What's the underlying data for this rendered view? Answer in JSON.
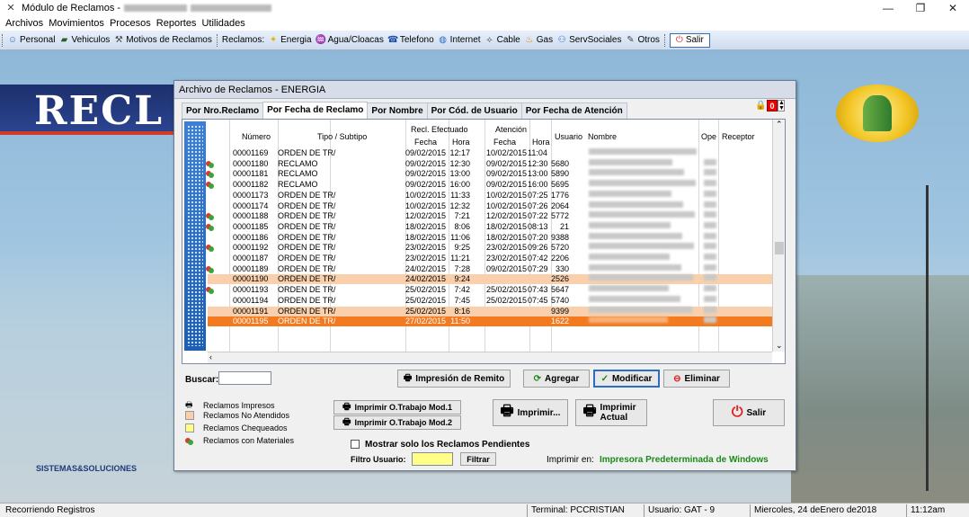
{
  "window": {
    "title": "Módulo de Reclamos - ",
    "minimize": "—",
    "maximize": "❐",
    "close": "✕"
  },
  "menu": [
    "Archivos",
    "Movimientos",
    "Procesos",
    "Reportes",
    "Utilidades"
  ],
  "toolbar": {
    "group1": [
      "Personal",
      "Vehiculos",
      "Motivos de Reclamos"
    ],
    "reclamos_label": "Reclamos:",
    "group2": [
      "Energia",
      "Agua/Cloacas",
      "Telefono",
      "Internet",
      "Cable",
      "Gas",
      "ServSociales",
      "Otros"
    ],
    "salir": "Salir"
  },
  "desktop": {
    "brand_text": "RECL",
    "sis_text": "SISTEMAS&SOLUCIONES"
  },
  "dialog": {
    "title": "Archivo de Reclamos - ENERGIA",
    "tabs": [
      "Por Nro.Reclamo",
      "Por Fecha de Reclamo",
      "Por Nombre",
      "Por Cód. de Usuario",
      "Por Fecha de Atención"
    ],
    "counter": "0",
    "headers": {
      "numero": "Número",
      "tipo": "Tipo / Subtipo",
      "recl_efect": "Recl. Efectuado",
      "atencion": "Atención",
      "fecha": "Fecha",
      "hora": "Hora",
      "fecha2": "Fecha",
      "hora2": "Hora",
      "usuario": "Usuario",
      "nombre": "Nombre",
      "ope": "Ope",
      "receptor": "Receptor"
    },
    "rows": [
      {
        "num": "00001169",
        "tipo": "ORDEN DE TR/",
        "fecha": "09/02/2015",
        "hora": "12:17",
        "afecha": "10/02/2015",
        "ahora": "11:04",
        "usuario": "",
        "mat": false,
        "sel": ""
      },
      {
        "num": "00001180",
        "tipo": "RECLAMO",
        "fecha": "09/02/2015",
        "hora": "12:30",
        "afecha": "09/02/2015",
        "ahora": "12:30",
        "usuario": "5680",
        "mat": true,
        "sel": ""
      },
      {
        "num": "00001181",
        "tipo": "RECLAMO",
        "fecha": "09/02/2015",
        "hora": "13:00",
        "afecha": "09/02/2015",
        "ahora": "13:00",
        "usuario": "5890",
        "mat": true,
        "sel": ""
      },
      {
        "num": "00001182",
        "tipo": "RECLAMO",
        "fecha": "09/02/2015",
        "hora": "16:00",
        "afecha": "09/02/2015",
        "ahora": "16:00",
        "usuario": "5695",
        "mat": true,
        "sel": ""
      },
      {
        "num": "00001173",
        "tipo": "ORDEN DE TR/",
        "fecha": "10/02/2015",
        "hora": "11:33",
        "afecha": "10/02/2015",
        "ahora": "07:25",
        "usuario": "1776",
        "mat": false,
        "sel": ""
      },
      {
        "num": "00001174",
        "tipo": "ORDEN DE TR/",
        "fecha": "10/02/2015",
        "hora": "12:32",
        "afecha": "10/02/2015",
        "ahora": "07:26",
        "usuario": "2064",
        "mat": false,
        "sel": ""
      },
      {
        "num": "00001188",
        "tipo": "ORDEN DE TR/",
        "fecha": "12/02/2015",
        "hora": "7:21",
        "afecha": "12/02/2015",
        "ahora": "07:22",
        "usuario": "5772",
        "mat": true,
        "sel": ""
      },
      {
        "num": "00001185",
        "tipo": "ORDEN DE TR/",
        "fecha": "18/02/2015",
        "hora": "8:06",
        "afecha": "18/02/2015",
        "ahora": "08:13",
        "usuario": "21",
        "mat": true,
        "sel": ""
      },
      {
        "num": "00001186",
        "tipo": "ORDEN DE TR/",
        "fecha": "18/02/2015",
        "hora": "11:06",
        "afecha": "18/02/2015",
        "ahora": "07:20",
        "usuario": "9388",
        "mat": false,
        "sel": ""
      },
      {
        "num": "00001192",
        "tipo": "ORDEN DE TR/",
        "fecha": "23/02/2015",
        "hora": "9:25",
        "afecha": "23/02/2015",
        "ahora": "09:26",
        "usuario": "5720",
        "mat": true,
        "sel": ""
      },
      {
        "num": "00001187",
        "tipo": "ORDEN DE TR/",
        "fecha": "23/02/2015",
        "hora": "11:21",
        "afecha": "23/02/2015",
        "ahora": "07:42",
        "usuario": "2206",
        "mat": false,
        "sel": ""
      },
      {
        "num": "00001189",
        "tipo": "ORDEN DE TR/",
        "fecha": "24/02/2015",
        "hora": "7:28",
        "afecha": "09/02/2015",
        "ahora": "07:29",
        "usuario": "330",
        "mat": true,
        "sel": ""
      },
      {
        "num": "00001190",
        "tipo": "ORDEN DE TR/",
        "fecha": "24/02/2015",
        "hora": "9:24",
        "afecha": "",
        "ahora": "",
        "usuario": "2526",
        "mat": false,
        "sel": "light"
      },
      {
        "num": "00001193",
        "tipo": "ORDEN DE TR/",
        "fecha": "25/02/2015",
        "hora": "7:42",
        "afecha": "25/02/2015",
        "ahora": "07:43",
        "usuario": "5647",
        "mat": true,
        "sel": ""
      },
      {
        "num": "00001194",
        "tipo": "ORDEN DE TR/",
        "fecha": "25/02/2015",
        "hora": "7:45",
        "afecha": "25/02/2015",
        "ahora": "07:45",
        "usuario": "5740",
        "mat": false,
        "sel": ""
      },
      {
        "num": "00001191",
        "tipo": "ORDEN DE TR/",
        "fecha": "25/02/2015",
        "hora": "8:16",
        "afecha": "",
        "ahora": "",
        "usuario": "9399",
        "mat": false,
        "sel": "light"
      },
      {
        "num": "00001195",
        "tipo": "ORDEN DE TR/",
        "fecha": "27/02/2015",
        "hora": "11:50",
        "afecha": "",
        "ahora": "",
        "usuario": "1622",
        "mat": false,
        "sel": "dark"
      }
    ],
    "buscar_label": "Buscar:",
    "btn_remito": "Impresión de Remito",
    "btn_agregar": "Agregar",
    "btn_modificar": "Modificar",
    "btn_eliminar": "Eliminar",
    "legend": [
      "Reclamos Impresos",
      "Reclamos No Atendidos",
      "Reclamos Chequeados",
      "Reclamos con Materiales"
    ],
    "btn_ot1": "Imprimir O.Trabajo Mod.1",
    "btn_ot2": "Imprimir O.Trabajo Mod.2",
    "btn_imprimir": "Imprimir...",
    "btn_imprimir_actual": "Imprimir Actual",
    "btn_salir": "Salir",
    "chk_pendientes": "Mostrar solo los Reclamos Pendientes",
    "filtro_label": "Filtro Usuario:",
    "btn_filtrar": "Filtrar",
    "imprimir_en_label": "Imprimir en:",
    "imprimir_en_value": "Impresora Predeterminada de Windows",
    "colors": {
      "sel_light": "#f9d0ab",
      "sel_dark": "#f47a1f",
      "printer_green": "#1a8a1a",
      "filtro_yellow": "#ffff88"
    }
  },
  "status": {
    "left": "Recorriendo Registros",
    "terminal": "Terminal: PCCRISTIAN",
    "usuario": "Usuario: GAT  -  9",
    "fecha": "Miercoles, 24 deEnero de2018",
    "hora": "11:12am"
  }
}
